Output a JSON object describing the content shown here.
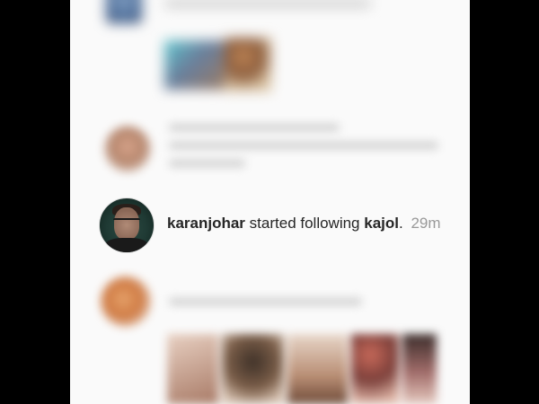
{
  "feed": {
    "highlighted_activity": {
      "actor": "karanjohar",
      "verb": "started following",
      "target": "kajol",
      "punctuation": ".",
      "time": "29m"
    }
  }
}
